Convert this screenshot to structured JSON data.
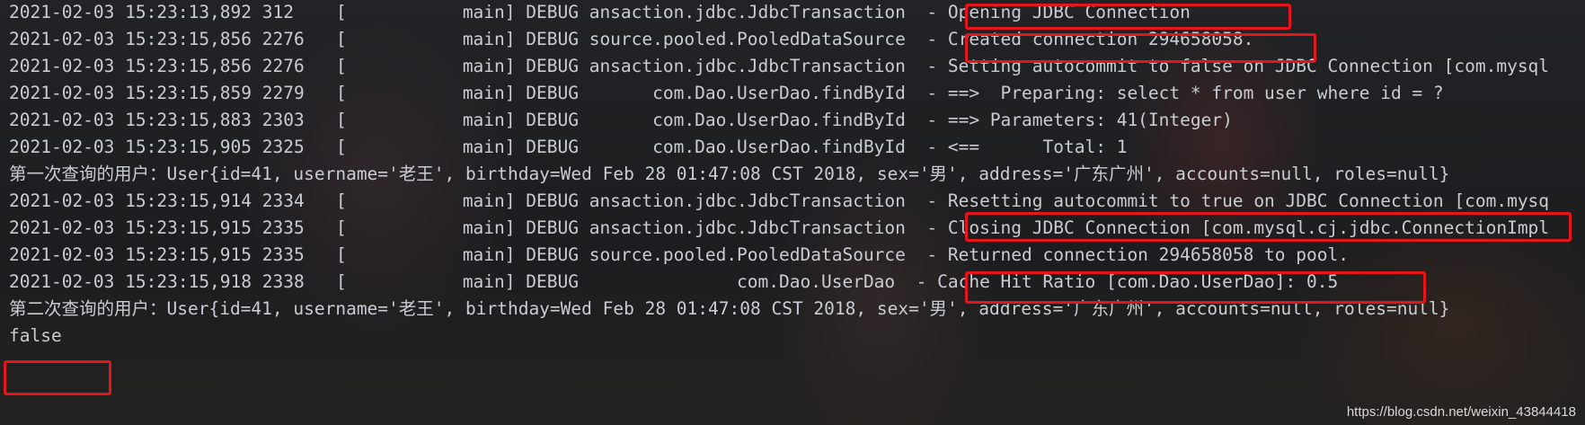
{
  "console": {
    "lines": [
      "2021-02-03 15:23:13,892 312    [           main] DEBUG ansaction.jdbc.JdbcTransaction  - Opening JDBC Connection",
      "2021-02-03 15:23:15,856 2276   [           main] DEBUG source.pooled.PooledDataSource  - Created connection 294658058.",
      "2021-02-03 15:23:15,856 2276   [           main] DEBUG ansaction.jdbc.JdbcTransaction  - Setting autocommit to false on JDBC Connection [com.mysql",
      "2021-02-03 15:23:15,859 2279   [           main] DEBUG       com.Dao.UserDao.findById  - ==>  Preparing: select * from user where id = ?",
      "2021-02-03 15:23:15,883 2303   [           main] DEBUG       com.Dao.UserDao.findById  - ==> Parameters: 41(Integer)",
      "2021-02-03 15:23:15,905 2325   [           main] DEBUG       com.Dao.UserDao.findById  - <==      Total: 1",
      "第一次查询的用户：User{id=41, username='老王', birthday=Wed Feb 28 01:47:08 CST 2018, sex='男', address='广东广州', accounts=null, roles=null}",
      "2021-02-03 15:23:15,914 2334   [           main] DEBUG ansaction.jdbc.JdbcTransaction  - Resetting autocommit to true on JDBC Connection [com.mysq",
      "2021-02-03 15:23:15,915 2335   [           main] DEBUG ansaction.jdbc.JdbcTransaction  - Closing JDBC Connection [com.mysql.cj.jdbc.ConnectionImpl",
      "2021-02-03 15:23:15,915 2335   [           main] DEBUG source.pooled.PooledDataSource  - Returned connection 294658058 to pool.",
      "2021-02-03 15:23:15,918 2338   [           main] DEBUG               com.Dao.UserDao  - Cache Hit Ratio [com.Dao.UserDao]: 0.5",
      "第二次查询的用户：User{id=41, username='老王', birthday=Wed Feb 28 01:47:08 CST 2018, sex='男', address='广东广州', accounts=null, roles=null}",
      "false"
    ]
  },
  "watermark": "https://blog.csdn.net/weixin_43844418",
  "colors": {
    "text": "#c9ccd2",
    "highlight": "#e4161c",
    "background": "#1e1f22"
  }
}
